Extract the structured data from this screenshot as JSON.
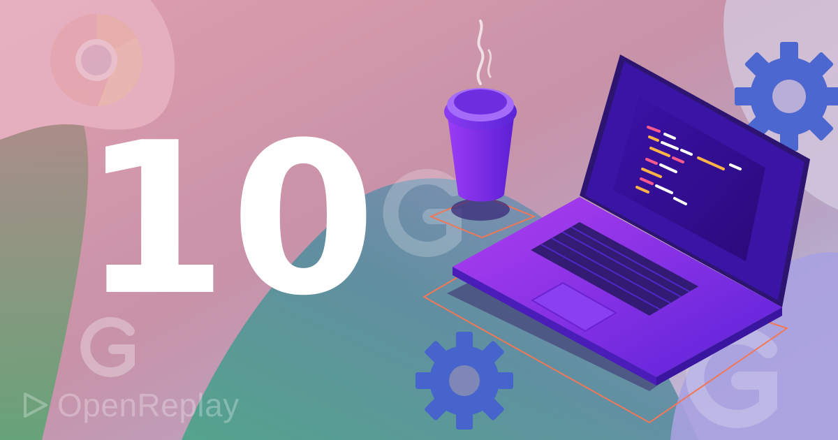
{
  "headline": {
    "number": "10"
  },
  "brand": {
    "name": "OpenReplay",
    "icon": "play-triangle-icon"
  },
  "decor": {
    "icons": [
      "chrome-logo-icon",
      "google-g-icon",
      "gear-icon",
      "coffee-cup-icon",
      "laptop-icon"
    ]
  },
  "colors": {
    "pink": "#d88a9c",
    "green": "#5ea178",
    "teal": "#4f9a96",
    "lavender": "#b7a6c7",
    "purple": "#7a2ce0",
    "gear_blue": "#4c67cf",
    "orange_outline": "#f27757"
  }
}
